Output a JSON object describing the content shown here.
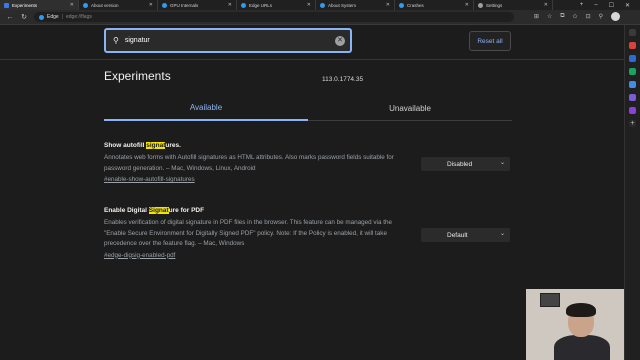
{
  "browser": {
    "tabs": [
      {
        "title": "Experiments",
        "active": true,
        "fav_color": "#3b78e7"
      },
      {
        "title": "About version",
        "active": false,
        "fav_color": "#2d9bf0"
      },
      {
        "title": "GPU Internals",
        "active": false,
        "fav_color": "#2d9bf0"
      },
      {
        "title": "Edge URLs",
        "active": false,
        "fav_color": "#2d9bf0"
      },
      {
        "title": "About System",
        "active": false,
        "fav_color": "#2d9bf0"
      },
      {
        "title": "Crashes",
        "active": false,
        "fav_color": "#2d9bf0"
      },
      {
        "title": "Settings",
        "active": false,
        "fav_color": "#9aa0a6"
      }
    ],
    "address": {
      "site": "Edge",
      "url": "edge://flags"
    }
  },
  "search": {
    "value": "signatur",
    "reset_label": "Reset all"
  },
  "page": {
    "title": "Experiments",
    "version": "113.0.1774.35",
    "tab_available": "Available",
    "tab_unavailable": "Unavailable"
  },
  "experiments": [
    {
      "title_before": "Show autofill ",
      "title_highlight": "signat",
      "title_after": "ures.",
      "description": "Annotates web forms with Autofill signatures as HTML attributes. Also marks password fields suitable for password generation. – Mac, Windows, Linux, Android",
      "link": "#enable-show-autofill-signatures",
      "selected": "Disabled"
    },
    {
      "title_before": "Enable Digital ",
      "title_highlight": "Signat",
      "title_after": "ure for PDF",
      "description": "Enables verification of digital signature in PDF files in the browser. This feature can be managed via the \"Enable Secure Environment for Digitally Signed PDF\" policy. Note: If the Policy is enabled, it will take precedence over the feature flag. – Mac, Windows",
      "link": "#edge-digsig-enabled-pdf",
      "selected": "Default"
    }
  ],
  "colors": {
    "accent": "#8ab4f8",
    "highlight": "#f2e400"
  }
}
